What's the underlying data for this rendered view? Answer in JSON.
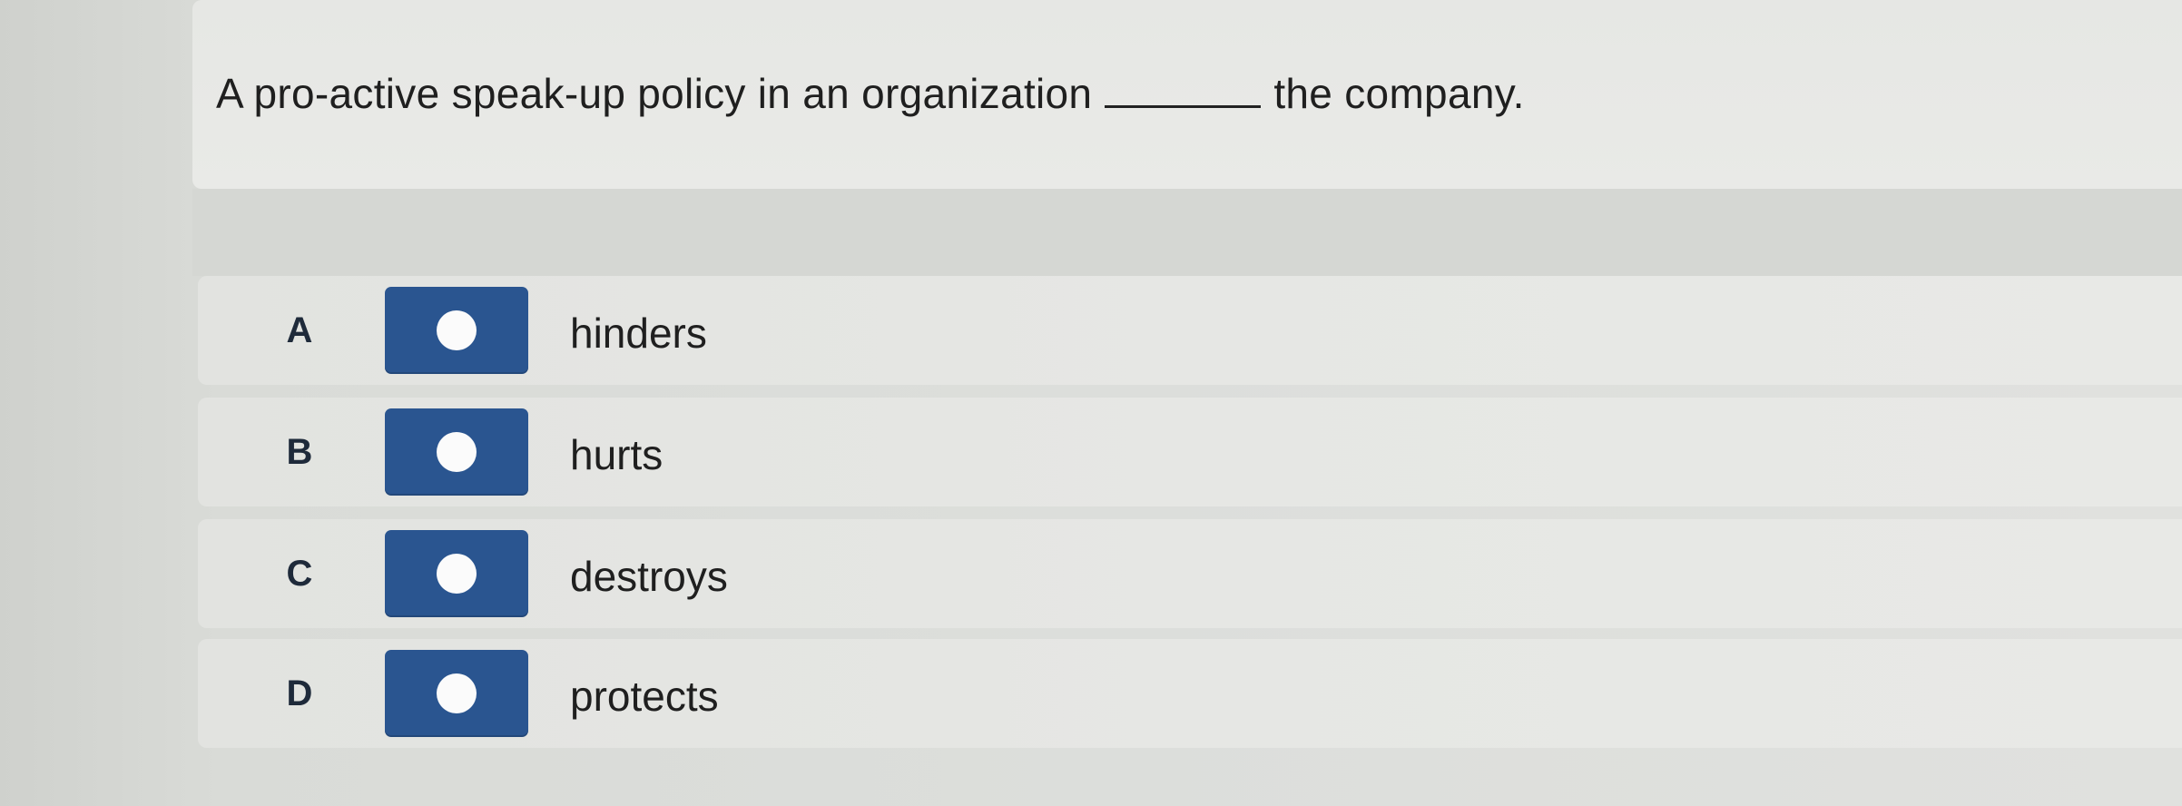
{
  "question": {
    "before_blank": "A pro-active speak-up policy in an organization",
    "after_blank": "the company."
  },
  "options": [
    {
      "letter": "A",
      "text": "hinders"
    },
    {
      "letter": "B",
      "text": "hurts"
    },
    {
      "letter": "C",
      "text": "destroys"
    },
    {
      "letter": "D",
      "text": "protects"
    }
  ],
  "colors": {
    "radio_fill": "#2a5590",
    "radio_dot": "#fbfbfb"
  }
}
